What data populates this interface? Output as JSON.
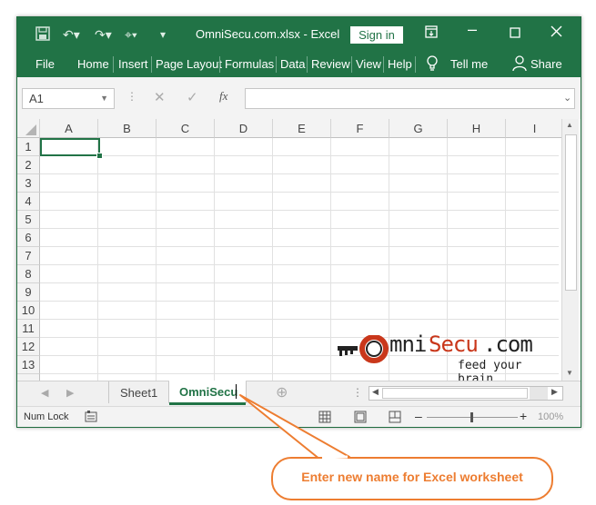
{
  "titlebar": {
    "filename": "OmniSecu.com.xlsx",
    "app": "Excel",
    "separator": "-",
    "signin_label": "Sign in"
  },
  "ribbon": {
    "tabs": [
      "File",
      "Home",
      "Insert",
      "Page Layout",
      "Formulas",
      "Data",
      "Review",
      "View",
      "Help"
    ],
    "tellme_label": "Tell me",
    "share_label": "Share"
  },
  "formula_bar": {
    "name_box": "A1",
    "fx": "fx",
    "formula": ""
  },
  "grid": {
    "columns": [
      "A",
      "B",
      "C",
      "D",
      "E",
      "F",
      "G",
      "H",
      "I"
    ],
    "rows": [
      "1",
      "2",
      "3",
      "4",
      "5",
      "6",
      "7",
      "8",
      "9",
      "10",
      "11",
      "12",
      "13"
    ],
    "selected_cell": "A1"
  },
  "watermark": {
    "brand_a": "mni",
    "brand_b": "Secu",
    "brand_c": ".com",
    "tagline": "feed your brain"
  },
  "sheets": {
    "tabs": [
      "Sheet1",
      "OmniSecu"
    ],
    "active": "OmniSecu"
  },
  "status": {
    "num_lock": "Num Lock",
    "zoom": "100%"
  },
  "callout": {
    "text": "Enter new name for Excel worksheet"
  },
  "colors": {
    "excel_green": "#217346",
    "callout_orange": "#ed7d31",
    "brand_red": "#c9371b"
  }
}
